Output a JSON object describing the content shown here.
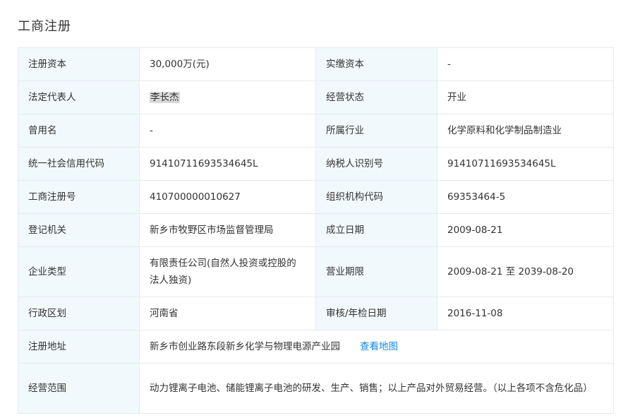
{
  "section": {
    "title": "工商注册"
  },
  "rows": [
    {
      "l1": "注册资本",
      "v1": "30,000万(元)",
      "l2": "实缴资本",
      "v2": "-"
    },
    {
      "l1": "法定代表人",
      "v1": "李长杰",
      "l2": "经营状态",
      "v2": "开业"
    },
    {
      "l1": "曾用名",
      "v1": "-",
      "l2": "所属行业",
      "v2": "化学原料和化学制品制造业"
    },
    {
      "l1": "统一社会信用代码",
      "v1": "91410711693534645L",
      "l2": "纳税人识别号",
      "v2": "91410711693534645L"
    },
    {
      "l1": "工商注册号",
      "v1": "410700000010627",
      "l2": "组织机构代码",
      "v2": "69353464-5"
    },
    {
      "l1": "登记机关",
      "v1": "新乡市牧野区市场监督管理局",
      "l2": "成立日期",
      "v2": "2009-08-21"
    },
    {
      "l1": "企业类型",
      "v1": "有限责任公司(自然人投资或控股的法人独资)",
      "l2": "营业期限",
      "v2": "2009-08-21 至 2039-08-20"
    },
    {
      "l1": "行政区划",
      "v1": "河南省",
      "l2": "审核/年检日期",
      "v2": "2016-11-08"
    }
  ],
  "address": {
    "label": "注册地址",
    "value": "新乡市创业路东段新乡化学与物理电源产业园",
    "map_link": "查看地图"
  },
  "scope": {
    "label": "经营范围",
    "value": "动力锂离子电池、储能锂离子电池的研发、生产、销售；以上产品对外贸易经营。（以上各项不含危化品）"
  }
}
